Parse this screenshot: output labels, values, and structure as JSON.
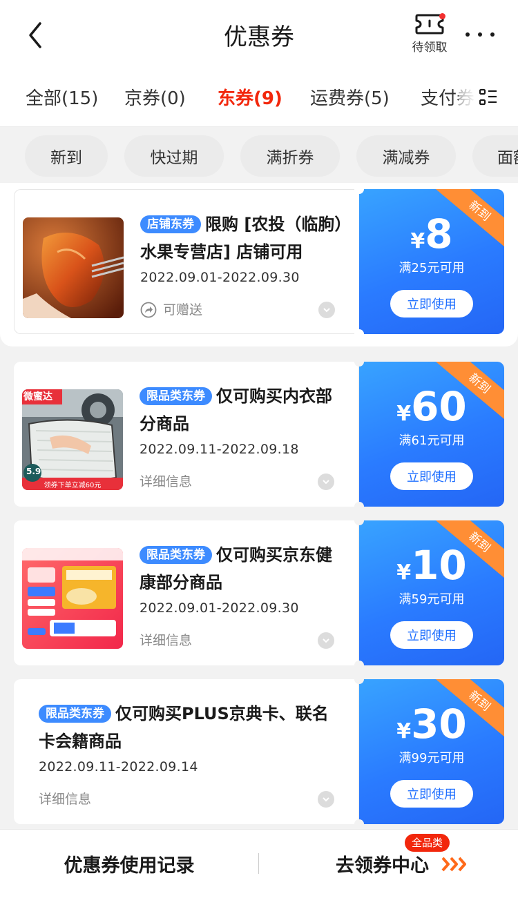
{
  "header": {
    "title": "优惠券",
    "pending_label": "待领取"
  },
  "tabs": [
    {
      "label": "全部(15)",
      "active": false
    },
    {
      "label": "京券(0)",
      "active": false
    },
    {
      "label": "东券(9)",
      "active": true
    },
    {
      "label": "运费券(5)",
      "active": false
    },
    {
      "label": "支付券",
      "active": false
    }
  ],
  "filters": [
    "新到",
    "快过期",
    "满折券",
    "满减券",
    "面额"
  ],
  "coupons": [
    {
      "tag": "店铺东券",
      "title": "限购 [农投（临朐）水果专营店] 店铺可用",
      "date": "2022.09.01-2022.09.30",
      "detail": "可赠送",
      "currency": "¥",
      "amount": "8",
      "condition": "满25元可用",
      "button": "立即使用",
      "ribbon": "新到"
    },
    {
      "tag": "限品类东券",
      "title": "仅可购买内衣部分商品",
      "date": "2022.09.11-2022.09.18",
      "detail": "详细信息",
      "currency": "¥",
      "amount": "60",
      "condition": "满61元可用",
      "button": "立即使用",
      "ribbon": "新到",
      "thumb_brand": "微蜜达",
      "thumb_price": "5.9",
      "thumb_caption": "领券下单立减60元"
    },
    {
      "tag": "限品类东券",
      "title": "仅可购买京东健康部分商品",
      "date": "2022.09.01-2022.09.30",
      "detail": "详细信息",
      "currency": "¥",
      "amount": "10",
      "condition": "满59元可用",
      "button": "立即使用",
      "ribbon": "新到"
    },
    {
      "tag": "限品类东券",
      "title": "仅可购买PLUS京典卡、联名卡会籍商品",
      "date": "2022.09.11-2022.09.14",
      "detail": "详细信息",
      "currency": "¥",
      "amount": "30",
      "condition": "满99元可用",
      "button": "立即使用",
      "ribbon": "新到"
    }
  ],
  "bottom": {
    "history_label": "优惠券使用记录",
    "center_label": "去领券中心",
    "badge": "全品类"
  },
  "colors": {
    "accent_red": "#f2270c",
    "coupon_blue": "#2a7bff",
    "ribbon_orange": "#ff8e35",
    "tag_blue": "#3d8bff"
  }
}
